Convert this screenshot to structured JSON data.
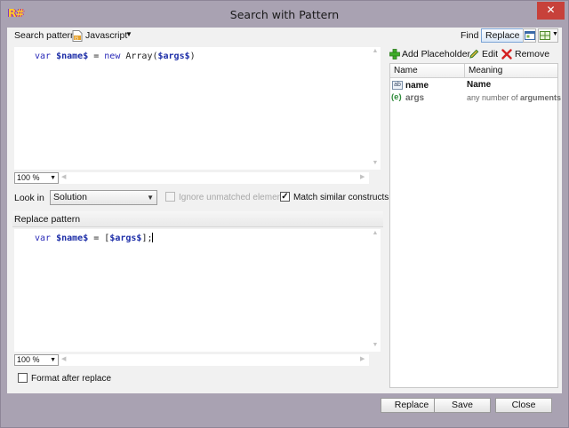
{
  "window": {
    "title": "Search with Pattern",
    "logo_text": "R#",
    "close_glyph": "✕"
  },
  "search": {
    "label": "Search pattern",
    "language": "Javascript",
    "code": {
      "kw1": "var",
      "ph1": "$name$",
      "t1": " = ",
      "kw2": "new",
      "t2": " Array(",
      "ph2": "$args$",
      "t3": ")"
    },
    "zoom": "100 %"
  },
  "find_replace": {
    "find_label": "Find",
    "replace_label": "Replace"
  },
  "options": {
    "look_in_label": "Look in",
    "look_in_value": "Solution",
    "ignore_unmatched_label": "Ignore unmatched elements",
    "ignore_unmatched_checked": false,
    "match_similar_label": "Match similar constructs",
    "match_similar_checked": true,
    "check_mark": "✓"
  },
  "replace": {
    "label": "Replace pattern",
    "code": {
      "kw1": "var",
      "ph1": "$name$",
      "t1": " = [",
      "ph2": "$args$",
      "t2": "];"
    },
    "zoom": "100 %",
    "format_after_label": "Format after replace",
    "format_after_checked": false
  },
  "placeholders": {
    "add_label": "Add Placeholder",
    "edit_label": "Edit",
    "remove_label": "Remove",
    "columns": [
      "Name",
      "Meaning"
    ],
    "rows": [
      {
        "icon_text": "ab",
        "name": "name",
        "meaning": "Name"
      },
      {
        "icon_text": "(e)",
        "name": "args",
        "meaning_pre": "any number of ",
        "meaning_bold": "arguments"
      }
    ]
  },
  "footer": {
    "replace_label": "Replace",
    "save_label": "Save",
    "close_label": "Close"
  },
  "colors": {
    "titlebar": "#a9a2b2",
    "close": "#c7413a",
    "keyword": "#2a2ab8",
    "placeholder": "#1e2fa8"
  }
}
